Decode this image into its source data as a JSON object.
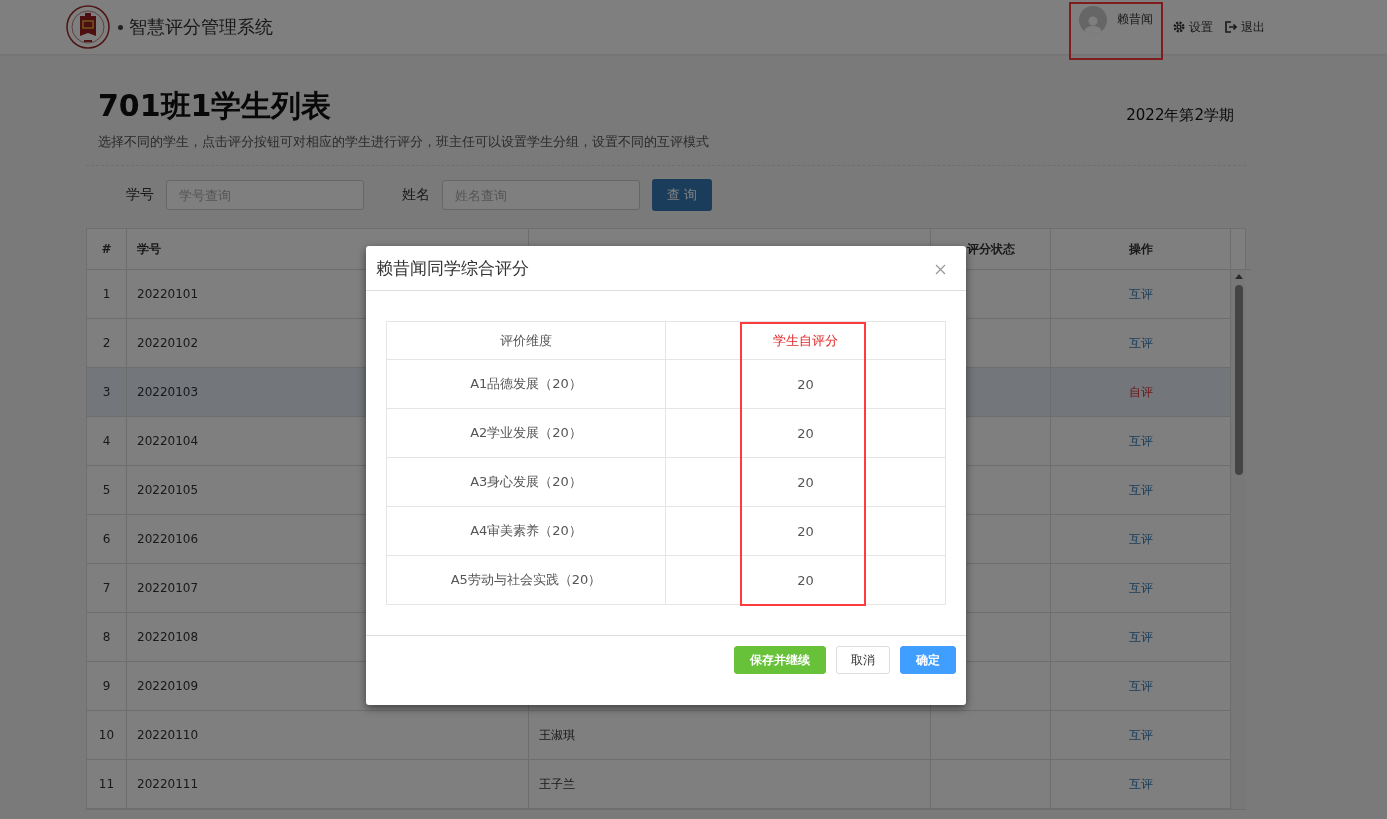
{
  "header": {
    "title": "智慧评分管理系统",
    "user": {
      "name": "赖昔闻",
      "highlighted": true
    },
    "links": [
      {
        "kind": "settings",
        "label": "设置"
      },
      {
        "kind": "logout",
        "label": "退出"
      }
    ]
  },
  "page": {
    "title": "701班1学生列表",
    "description": "选择不同的学生，点击评分按钮可对相应的学生进行评分，班主任可以设置学生分组，设置不同的互评模式",
    "term": "2022年第2学期"
  },
  "filters": [
    {
      "label": "学号",
      "placeholder": "学号查询"
    },
    {
      "label": "姓名",
      "placeholder": "姓名查询"
    }
  ],
  "query_button": "查 询",
  "table": {
    "columns": [
      "#",
      "学号",
      "",
      "评分状态",
      "操作"
    ],
    "rows": [
      {
        "index": "1",
        "id": "20220101",
        "name": "",
        "action": {
          "label": "互评",
          "kind": "peer"
        },
        "selected": false
      },
      {
        "index": "2",
        "id": "20220102",
        "name": "",
        "action": {
          "label": "互评",
          "kind": "peer"
        },
        "selected": false
      },
      {
        "index": "3",
        "id": "20220103",
        "name": "",
        "action": {
          "label": "自评",
          "kind": "self"
        },
        "selected": true
      },
      {
        "index": "4",
        "id": "20220104",
        "name": "",
        "action": {
          "label": "互评",
          "kind": "peer"
        },
        "selected": false
      },
      {
        "index": "5",
        "id": "20220105",
        "name": "",
        "action": {
          "label": "互评",
          "kind": "peer"
        },
        "selected": false
      },
      {
        "index": "6",
        "id": "20220106",
        "name": "",
        "action": {
          "label": "互评",
          "kind": "peer"
        },
        "selected": false
      },
      {
        "index": "7",
        "id": "20220107",
        "name": "",
        "action": {
          "label": "互评",
          "kind": "peer"
        },
        "selected": false
      },
      {
        "index": "8",
        "id": "20220108",
        "name": "",
        "action": {
          "label": "互评",
          "kind": "peer"
        },
        "selected": false
      },
      {
        "index": "9",
        "id": "20220109",
        "name": "",
        "action": {
          "label": "互评",
          "kind": "peer"
        },
        "selected": false
      },
      {
        "index": "10",
        "id": "20220110",
        "name": "王淑琪",
        "action": {
          "label": "互评",
          "kind": "peer"
        },
        "selected": false
      },
      {
        "index": "11",
        "id": "20220111",
        "name": "王子兰",
        "action": {
          "label": "互评",
          "kind": "peer"
        },
        "selected": false
      }
    ]
  },
  "dialog": {
    "title": "赖昔闻同学综合评分",
    "columns": [
      {
        "label": "评价维度",
        "highlighted": false
      },
      {
        "label": "学生自评分",
        "highlighted": true
      }
    ],
    "rows": [
      {
        "dimension": "A1品德发展（20）",
        "score": "20"
      },
      {
        "dimension": "A2学业发展（20）",
        "score": "20"
      },
      {
        "dimension": "A3身心发展（20）",
        "score": "20"
      },
      {
        "dimension": "A4审美素养（20）",
        "score": "20"
      },
      {
        "dimension": "A5劳动与社会实践（20）",
        "score": "20"
      }
    ],
    "buttons": [
      {
        "label": "保存并继续",
        "kind": "success"
      },
      {
        "label": "取消",
        "kind": "default"
      },
      {
        "label": "确定",
        "kind": "primary"
      }
    ]
  }
}
